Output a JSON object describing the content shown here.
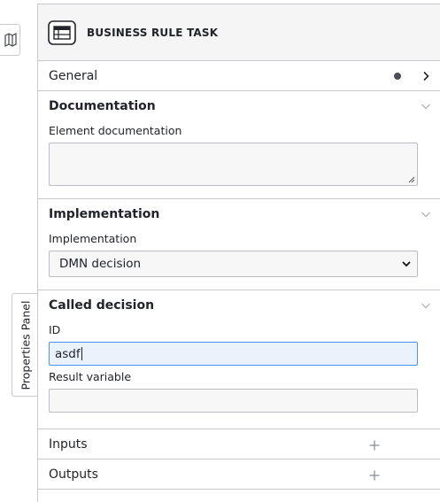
{
  "panel_toggle": {
    "label": "Properties Panel"
  },
  "header": {
    "title": "BUSINESS RULE TASK"
  },
  "groups": {
    "general": {
      "title": "General"
    },
    "documentation": {
      "title": "Documentation",
      "field_label": "Element documentation",
      "value": ""
    },
    "implementation": {
      "title": "Implementation",
      "field_label": "Implementation",
      "selected": "DMN decision"
    },
    "called_decision": {
      "title": "Called decision",
      "id_label": "ID",
      "id_value": "asdf",
      "result_label": "Result variable",
      "result_value": ""
    },
    "inputs": {
      "title": "Inputs"
    },
    "outputs": {
      "title": "Outputs"
    }
  },
  "icons": {
    "map": "map-icon",
    "header": "business-rule-task-icon",
    "chevron_right": "chevron-right-icon",
    "chevron_down": "chevron-down-icon",
    "plus": "plus-icon"
  },
  "colors": {
    "focus_border": "#4d90ff",
    "focus_bg": "#eaf3fb",
    "border": "#c7c9ce"
  }
}
